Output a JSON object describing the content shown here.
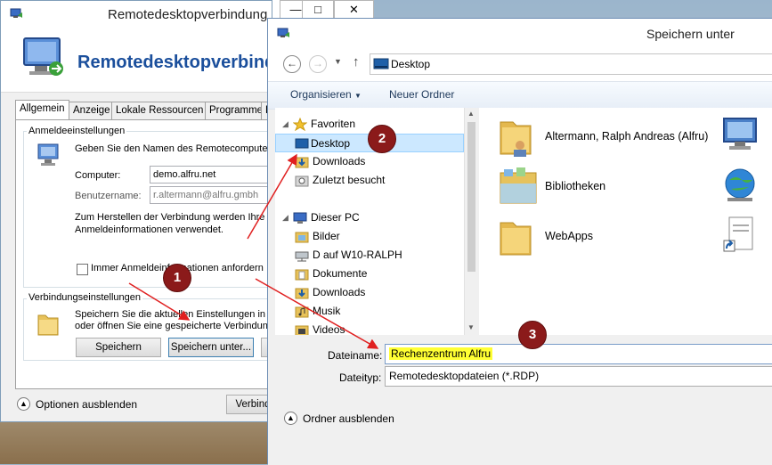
{
  "rdc": {
    "title": "Remotedesktopverbindung",
    "header": "Remotedesktopverbindung",
    "tabs": [
      "Allgemein",
      "Anzeige",
      "Lokale Ressourcen",
      "Programme",
      "E"
    ],
    "login_group": "Anmeldeeinstellungen",
    "login_hint": "Geben Sie den Namen des Remotecomputers e",
    "computer_label": "Computer:",
    "computer_value": "demo.alfru.net",
    "user_label": "Benutzername:",
    "user_value": "r.altermann@alfru.gmbh",
    "cred_text_1": "Zum Herstellen der Verbindung werden Ihre W",
    "cred_text_2": "Anmeldeinformationen verwendet.",
    "ask_checkbox": "Immer Anmeldeinformationen anfordern",
    "conn_group": "Verbindungseinstellungen",
    "conn_text_1": "Speichern Sie die aktuellen Einstellungen in ei",
    "conn_text_2": "oder öffnen Sie eine gespeicherte Verbindung",
    "btn_save": "Speichern",
    "btn_save_as": "Speichern unter...",
    "options_toggle": "Optionen ausblenden",
    "connect_btn": "Verbind"
  },
  "window_controls": {
    "minimize": "—",
    "maximize": "□",
    "close": "✕"
  },
  "dialog": {
    "title": "Speichern unter",
    "address": "Desktop",
    "organize": "Organisieren",
    "new_folder": "Neuer Ordner",
    "nav": {
      "favorites": "Favoriten",
      "favorites_items": [
        "Desktop",
        "Downloads",
        "Zuletzt besucht"
      ],
      "this_pc": "Dieser PC",
      "pc_items": [
        "Bilder",
        "D auf W10-RALPH",
        "Dokumente",
        "Downloads",
        "Musik",
        "Videos"
      ]
    },
    "items": [
      "Altermann, Ralph Andreas (Alfru)",
      "Bibliotheken",
      "WebApps"
    ],
    "filename_label": "Dateiname:",
    "filename_value": "Rechenzentrum Alfru",
    "filetype_label": "Dateityp:",
    "filetype_value": "Remotedesktopdateien (*.RDP)",
    "hide_folders": "Ordner ausblenden"
  },
  "annotations": {
    "one": "1",
    "two": "2",
    "three": "3"
  },
  "colors": {
    "highlight": "#ffff33",
    "badge": "#8b1a1a",
    "arrow": "#e02020",
    "accent": "#1b4f9c"
  }
}
